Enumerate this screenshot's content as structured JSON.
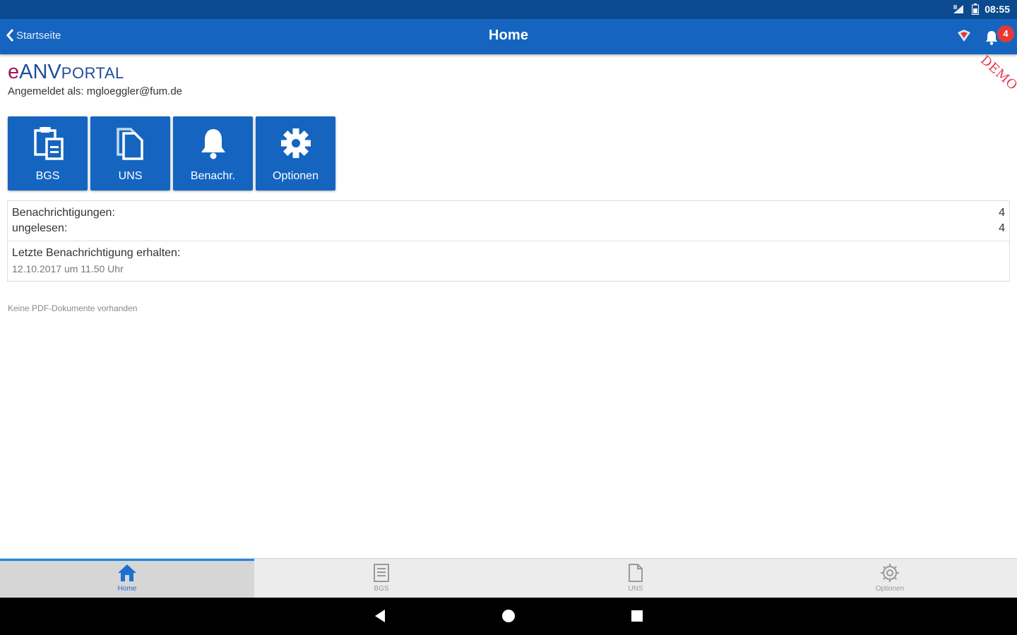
{
  "status": {
    "time": "08:55"
  },
  "appbar": {
    "back_label": "Startseite",
    "title": "Home",
    "notification_count": "4"
  },
  "logo": {
    "e": "e",
    "anv": "ANV",
    "portal": "PORTAL"
  },
  "user": {
    "logged_in_text": "Angemeldet als: mgloeggler@fum.de"
  },
  "demo_label": "DEMO",
  "tiles": [
    {
      "label": "BGS",
      "icon": "clipboard-doc-icon"
    },
    {
      "label": "UNS",
      "icon": "documents-icon"
    },
    {
      "label": "Benachr.",
      "icon": "bell-icon"
    },
    {
      "label": "Optionen",
      "icon": "gear-icon"
    }
  ],
  "info": {
    "notifications_label": "Benachrichtigungen:",
    "notifications_value": "4",
    "unread_label": "ungelesen:",
    "unread_value": "4",
    "last_label": "Letzte Benachrichtigung erhalten:",
    "last_value": "12.10.2017 um 11.50 Uhr"
  },
  "no_docs_text": "Keine PDF-Dokumente vorhanden",
  "tabbar": [
    {
      "label": "Home",
      "icon": "home-icon",
      "active": true
    },
    {
      "label": "BGS",
      "icon": "list-doc-icon",
      "active": false
    },
    {
      "label": "UNS",
      "icon": "document-icon",
      "active": false
    },
    {
      "label": "Optionen",
      "icon": "gear-icon",
      "active": false
    }
  ],
  "colors": {
    "primary": "#1565c0",
    "status_bar": "#0b4a8e",
    "badge": "#e53935",
    "logo_e": "#a0135c",
    "logo_anv": "#1f4e9c",
    "demo": "#e53950",
    "tab_active": "#1e88e5"
  }
}
